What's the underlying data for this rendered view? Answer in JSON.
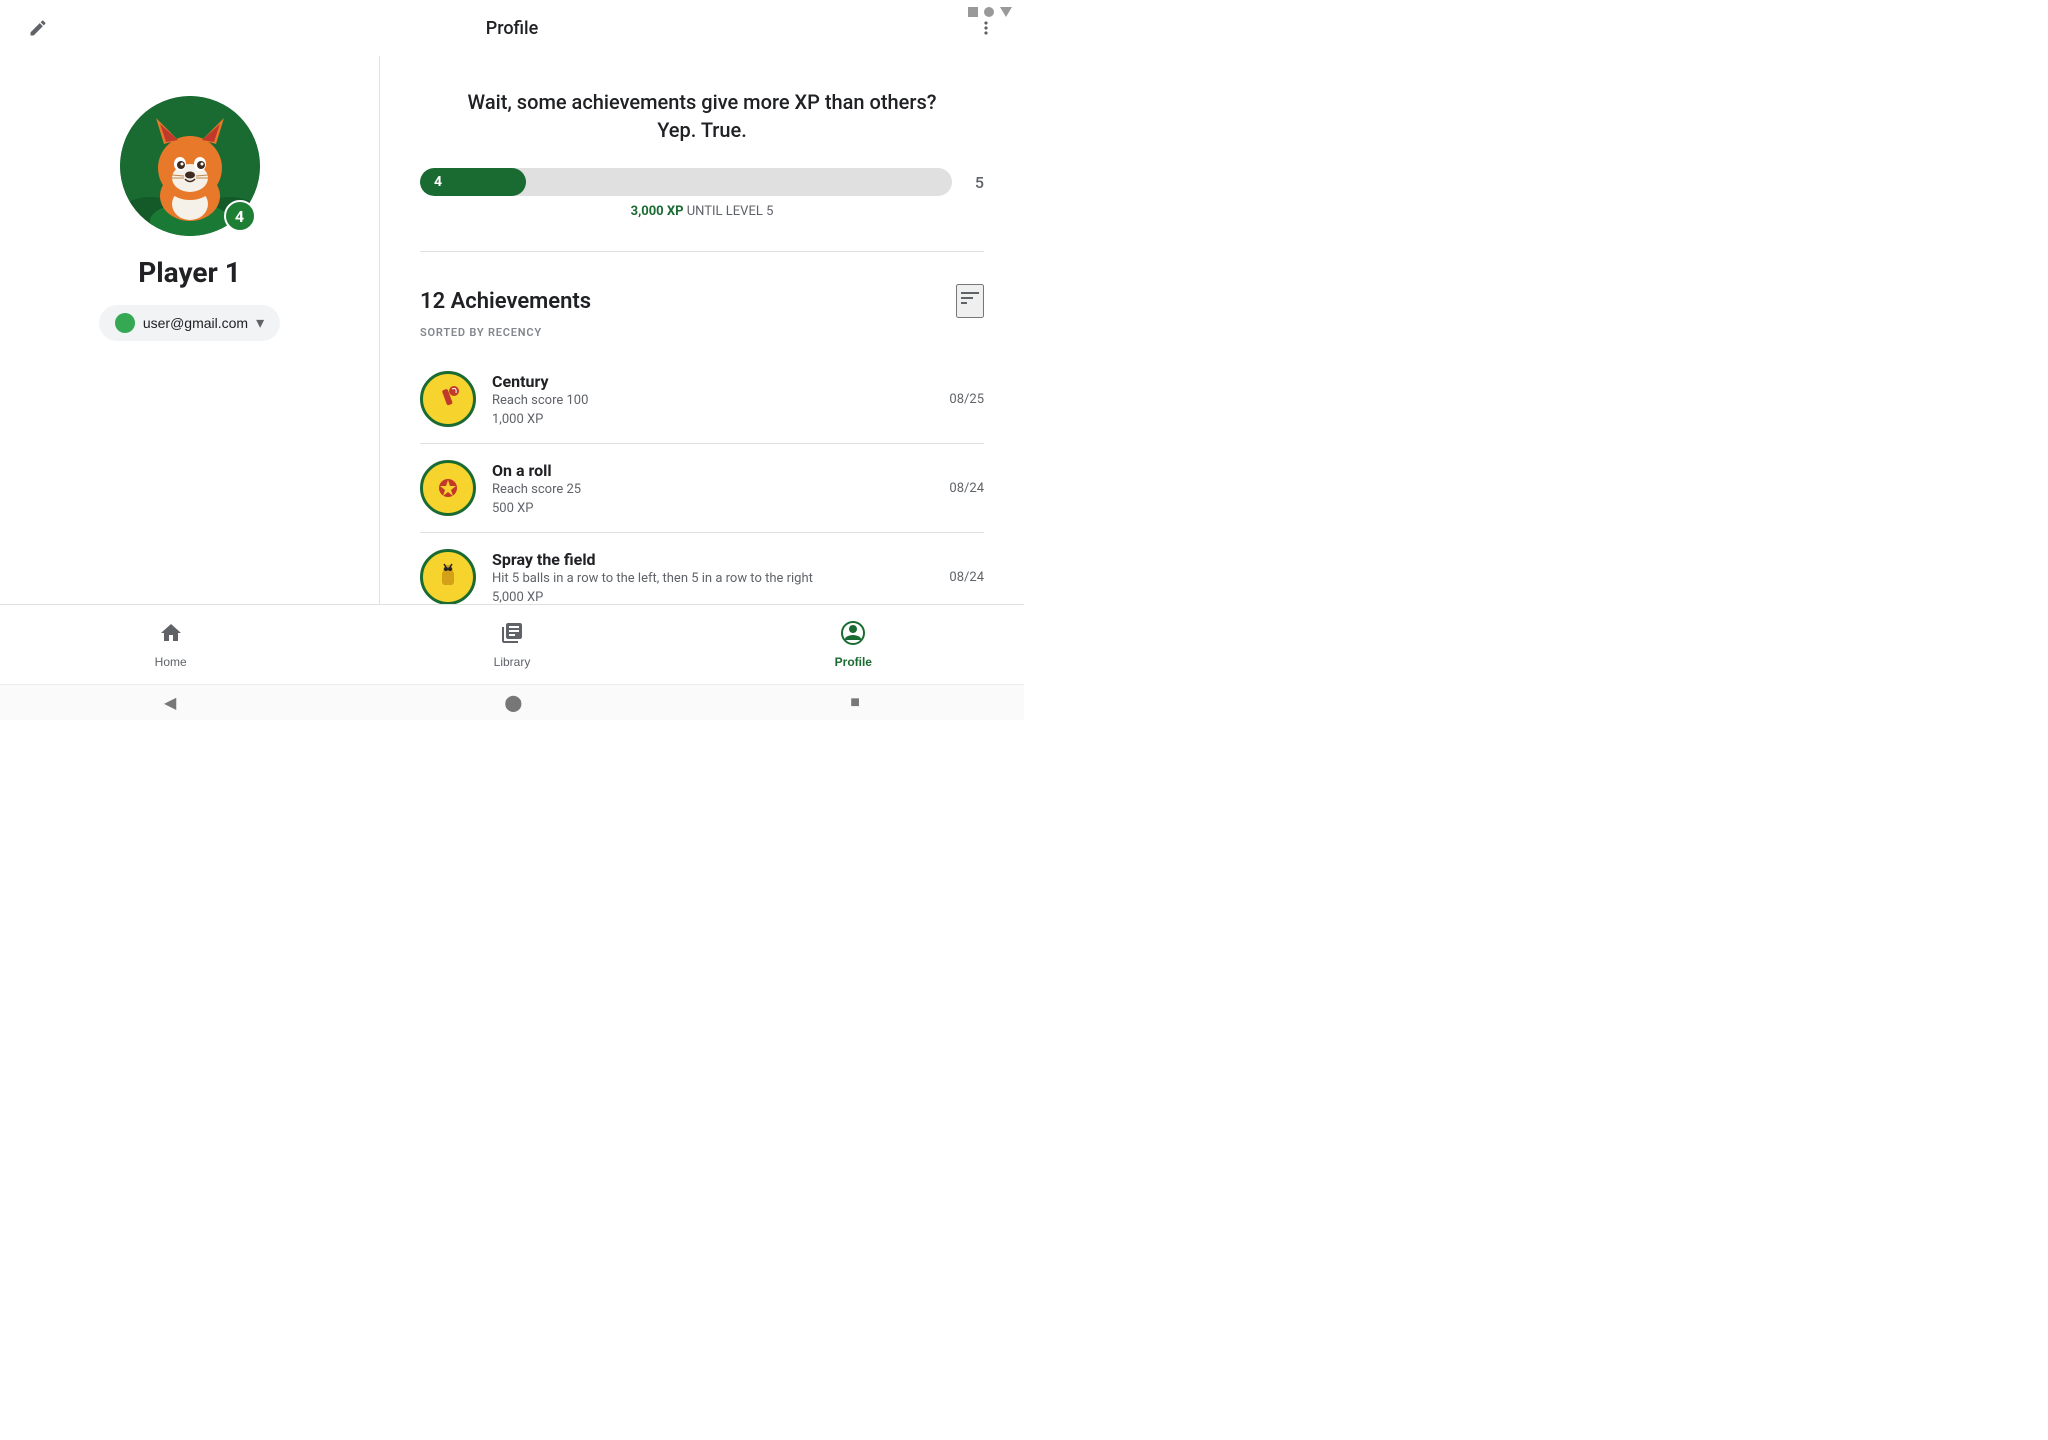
{
  "statusBar": {
    "icons": [
      "square",
      "circle",
      "triangle"
    ]
  },
  "appBar": {
    "title": "Profile",
    "editIcon": "✏",
    "moreIcon": "⋮"
  },
  "player": {
    "name": "Player 1",
    "email": "user@gmail.com",
    "level": "4"
  },
  "xpSection": {
    "headline": "Wait, some achievements give more XP than others?\nYep. True.",
    "currentLevel": "4",
    "nextLevel": "5",
    "progressPercent": 20,
    "xpUntil": "3,000 XP",
    "untilLabel": "UNTIL LEVEL 5"
  },
  "achievements": {
    "title": "12 Achievements",
    "sortLabel": "SORTED BY RECENCY",
    "items": [
      {
        "name": "Century",
        "description": "Reach score 100",
        "xp": "1,000 XP",
        "date": "08/25",
        "iconType": "century"
      },
      {
        "name": "On a roll",
        "description": "Reach score 25",
        "xp": "500 XP",
        "date": "08/24",
        "iconType": "on-a-roll"
      },
      {
        "name": "Spray the field",
        "description": "Hit 5 balls in a row to the left, then 5 in a row to the right",
        "xp": "5,000 XP",
        "date": "08/24",
        "iconType": "spray"
      }
    ]
  },
  "bottomNav": {
    "items": [
      {
        "label": "Home",
        "icon": "home",
        "active": false
      },
      {
        "label": "Library",
        "icon": "library",
        "active": false
      },
      {
        "label": "Profile",
        "icon": "profile",
        "active": true
      }
    ]
  },
  "systemNav": {
    "back": "◀",
    "home": "⬤",
    "recents": "■"
  }
}
